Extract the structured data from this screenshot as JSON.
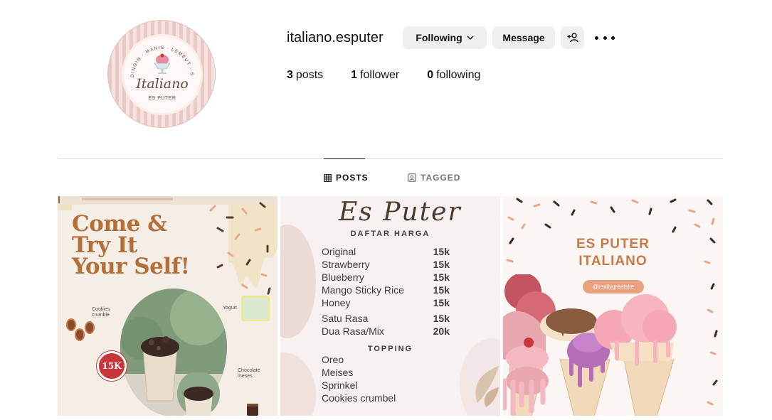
{
  "profile": {
    "username": "italiano.esputer",
    "avatar": {
      "brand": "Italiano",
      "sub": "ES PUTER",
      "arc_text": "DINGIN · MANIS · LEMBUT · SEHAT"
    }
  },
  "actions": {
    "following_label": "Following",
    "message_label": "Message",
    "add_user_icon": "person-plus-icon",
    "more_icon": "more-dots-icon"
  },
  "stats": {
    "posts_count": "3",
    "posts_label": "posts",
    "followers_count": "1",
    "followers_label": "follower",
    "following_count": "0",
    "following_label": "following"
  },
  "tabs": [
    {
      "label": "POSTS",
      "icon": "grid-icon",
      "active": true
    },
    {
      "label": "TAGGED",
      "icon": "tag-user-icon",
      "active": false
    }
  ],
  "posts": [
    {
      "headline": "Come &\nTry It\nYour Self!",
      "badge": "15K",
      "label_cookies": "Cookies\ncrumble",
      "label_yogurt": "Yogurt",
      "label_choco": "Chocolate\nmeses"
    },
    {
      "title": "Es Puter",
      "subtitle": "DAFTAR HARGA",
      "menu": [
        {
          "name": "Original",
          "price": "15k"
        },
        {
          "name": "Strawberry",
          "price": "15k"
        },
        {
          "name": "Blueberry",
          "price": "15k"
        },
        {
          "name": "Mango Sticky Rice",
          "price": "15k"
        },
        {
          "name": "Honey",
          "price": "15k"
        }
      ],
      "menu2": [
        {
          "name": "Satu Rasa",
          "price": "15k"
        },
        {
          "name": "Dua Rasa/Mix",
          "price": "20k"
        }
      ],
      "topping_title": "TOPPING",
      "toppings": [
        "Oreo",
        "Meises",
        "Sprinkel",
        "Cookies crumbel"
      ]
    },
    {
      "title": "ES PUTER\nITALIANO",
      "pill": "@reallygreatsite"
    }
  ]
}
